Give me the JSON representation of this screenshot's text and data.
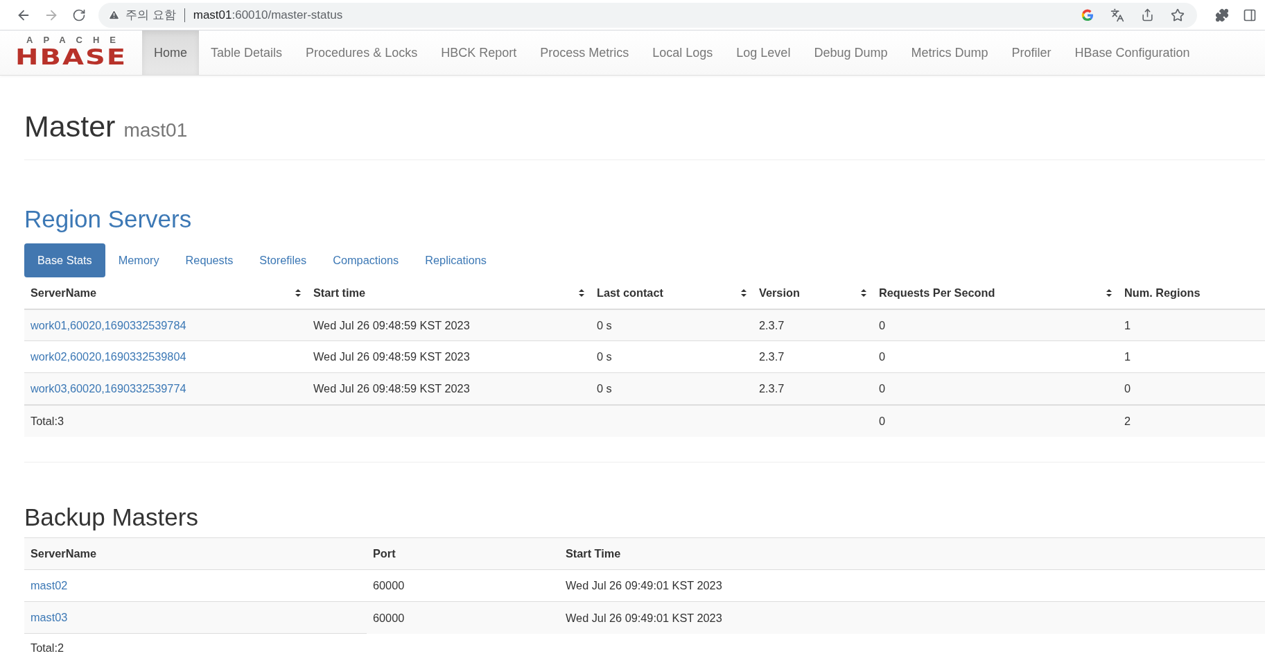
{
  "browser": {
    "forward_disabled": true,
    "security_label": "주의 요함",
    "url_host": "mast01",
    "url_path": ":60010/master-status"
  },
  "navbar": {
    "logo": {
      "top": "APACHE",
      "bottom": "HBASE"
    },
    "items": [
      {
        "label": "Home",
        "selected": true
      },
      {
        "label": "Table Details",
        "selected": false
      },
      {
        "label": "Procedures & Locks",
        "selected": false
      },
      {
        "label": "HBCK Report",
        "selected": false
      },
      {
        "label": "Process Metrics",
        "selected": false
      },
      {
        "label": "Local Logs",
        "selected": false
      },
      {
        "label": "Log Level",
        "selected": false
      },
      {
        "label": "Debug Dump",
        "selected": false
      },
      {
        "label": "Metrics Dump",
        "selected": false
      },
      {
        "label": "Profiler",
        "selected": false
      },
      {
        "label": "HBase Configuration",
        "selected": false
      }
    ]
  },
  "page": {
    "title": "Master",
    "subtitle": "mast01"
  },
  "region_servers": {
    "heading": "Region Servers",
    "tabs": [
      {
        "label": "Base Stats",
        "selected": true
      },
      {
        "label": "Memory",
        "selected": false
      },
      {
        "label": "Requests",
        "selected": false
      },
      {
        "label": "Storefiles",
        "selected": false
      },
      {
        "label": "Compactions",
        "selected": false
      },
      {
        "label": "Replications",
        "selected": false
      }
    ],
    "columns": [
      {
        "label": "ServerName",
        "sortable": true
      },
      {
        "label": "Start time",
        "sortable": true
      },
      {
        "label": "Last contact",
        "sortable": true
      },
      {
        "label": "Version",
        "sortable": true
      },
      {
        "label": "Requests Per Second",
        "sortable": true
      },
      {
        "label": "Num. Regions",
        "sortable": false
      }
    ],
    "rows": [
      [
        "work01,60020,1690332539784",
        "Wed Jul 26 09:48:59 KST 2023",
        "0 s",
        "2.3.7",
        "0",
        "1"
      ],
      [
        "work02,60020,1690332539804",
        "Wed Jul 26 09:48:59 KST 2023",
        "0 s",
        "2.3.7",
        "0",
        "1"
      ],
      [
        "work03,60020,1690332539774",
        "Wed Jul 26 09:48:59 KST 2023",
        "0 s",
        "2.3.7",
        "0",
        "0"
      ]
    ],
    "total": {
      "label": "Total:3",
      "requests": "0",
      "regions": "2"
    }
  },
  "backup_masters": {
    "heading": "Backup Masters",
    "columns": [
      "ServerName",
      "Port",
      "Start Time"
    ],
    "rows": [
      [
        "mast02",
        "60000",
        "Wed Jul 26 09:49:01 KST 2023"
      ],
      [
        "mast03",
        "60000",
        "Wed Jul 26 09:49:01 KST 2023"
      ]
    ],
    "total": "Total:2"
  }
}
